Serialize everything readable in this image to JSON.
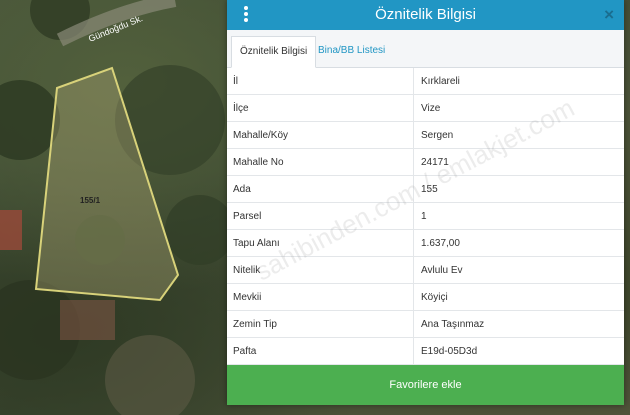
{
  "map": {
    "road_label": "Gündoğdu Sk.",
    "parcel_label": "155/1"
  },
  "panel": {
    "title": "Öznitelik Bilgisi",
    "close_glyph": "×",
    "tabs": [
      {
        "label": "Öznitelik Bilgisi"
      },
      {
        "label": "Bina/BB Listesi"
      }
    ],
    "rows": [
      {
        "key": "İl",
        "value": "Kırklareli"
      },
      {
        "key": "İlçe",
        "value": "Vize"
      },
      {
        "key": "Mahalle/Köy",
        "value": "Sergen"
      },
      {
        "key": "Mahalle No",
        "value": "24171"
      },
      {
        "key": "Ada",
        "value": "155"
      },
      {
        "key": "Parsel",
        "value": "1"
      },
      {
        "key": "Tapu Alanı",
        "value": "1.637,00"
      },
      {
        "key": "Nitelik",
        "value": "Avlulu Ev"
      },
      {
        "key": "Mevkii",
        "value": "Köyiçi"
      },
      {
        "key": "Zemin Tip",
        "value": "Ana Taşınmaz"
      },
      {
        "key": "Pafta",
        "value": "E19d-05D3d"
      }
    ],
    "favorite_button": "Favorilere ekle"
  },
  "watermark": "sahibinden.com / emlakjet.com",
  "colors": {
    "header": "#2196c4",
    "button": "#4caf50",
    "parcel_outline": "#d8d27a"
  }
}
